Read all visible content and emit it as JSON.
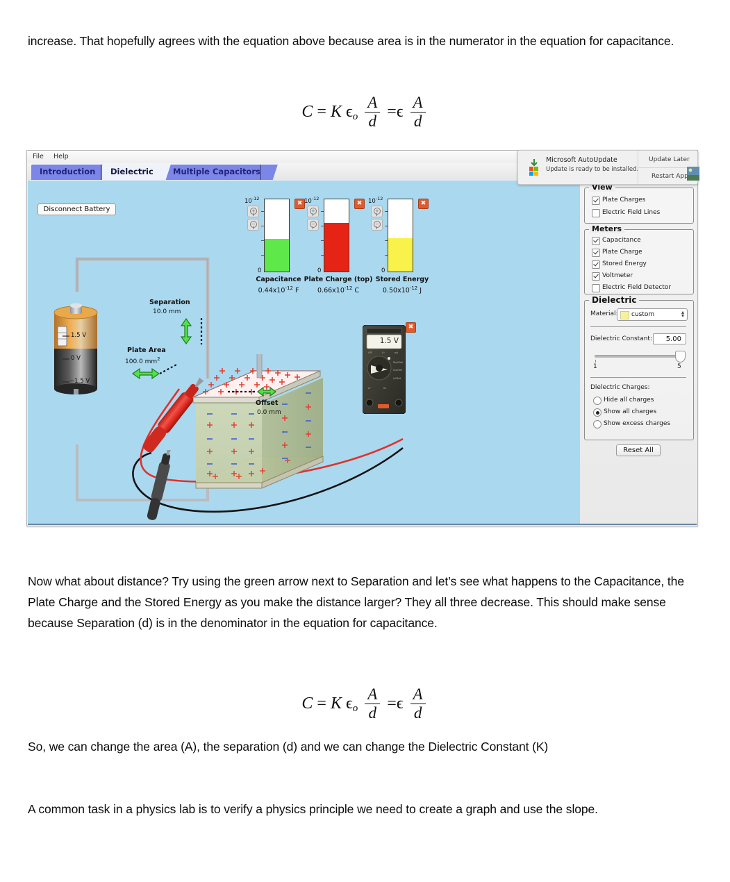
{
  "document": {
    "para1": "increase.  That hopefully agrees with the equation above because area is in the numerator in the equation for capacitance.",
    "para2": "Now what about distance?  Try using the green arrow next to Separation and let’s see what happens to the Capacitance, the Plate Charge and the Stored Energy as you make the distance larger?  They all three decrease.  This should make sense because Separation (d) is in the denominator in the equation for capacitance.",
    "para3": "So, we can change the area (A), the separation (d) and we can change the Dielectric Constant (K)",
    "para4": "A common task in a physics lab is to verify a physics principle we need to create a graph and use the slope.",
    "equation": {
      "lhs": "C",
      "eq1": "=",
      "k": "K",
      "eps": "ϵ",
      "eps_sub": "o",
      "num1": "A",
      "den1": "d",
      "eq2": "=",
      "eps2": "ϵ",
      "num2": "A",
      "den2": "d"
    }
  },
  "sim": {
    "menu": {
      "file": "File",
      "help": "Help"
    },
    "tabs": [
      {
        "label": "Introduction",
        "active": false
      },
      {
        "label": "Dielectric",
        "active": true
      },
      {
        "label": "Multiple Capacitors",
        "active": false
      }
    ],
    "canvas": {
      "disconnect_battery": "Disconnect Battery",
      "battery": {
        "top_label": "1.5 V",
        "mid_label": "0 V",
        "bottom_label": "−1.5 V"
      },
      "separation": {
        "title": "Separation",
        "value": "10.0 mm"
      },
      "plate_area": {
        "title": "Plate Area",
        "value": "100.0 mm",
        "value_sup": "2"
      },
      "offset": {
        "title": "Offset",
        "value": "0.0 mm"
      },
      "voltmeter": {
        "reading": "1.5 V"
      }
    },
    "meters": [
      {
        "exponent_base": "10",
        "exponent_sup": "-12",
        "zero": "0",
        "title": "Capacitance",
        "value_mantissa": "0.44x10",
        "value_sup": "-12",
        "value_unit": "F",
        "fill_color": "#5ee84a",
        "fill_fraction": 0.45
      },
      {
        "exponent_base": "10",
        "exponent_sup": "-12",
        "zero": "0",
        "title": "Plate Charge (top)",
        "value_mantissa": "0.66x10",
        "value_sup": "-12",
        "value_unit": "C",
        "fill_color": "#e62415",
        "fill_fraction": 0.67
      },
      {
        "exponent_base": "10",
        "exponent_sup": "-12",
        "zero": "0",
        "title": "Stored Energy",
        "value_mantissa": "0.50x10",
        "value_sup": "-12",
        "value_unit": "J",
        "fill_color": "#f8f24a",
        "fill_fraction": 0.46
      }
    ],
    "panel": {
      "view": {
        "legend": "View",
        "items": [
          {
            "label": "Plate Charges",
            "checked": true
          },
          {
            "label": "Electric Field Lines",
            "checked": false
          }
        ]
      },
      "meters_group": {
        "legend": "Meters",
        "items": [
          {
            "label": "Capacitance",
            "checked": true
          },
          {
            "label": "Plate Charge",
            "checked": true
          },
          {
            "label": "Stored Energy",
            "checked": true
          },
          {
            "label": "Voltmeter",
            "checked": true
          },
          {
            "label": "Electric Field Detector",
            "checked": false
          }
        ]
      },
      "dielectric": {
        "legend": "Dielectric",
        "material_label": "Material:",
        "material_value": "custom",
        "material_swatch": "#f7f29a",
        "constant_label": "Dielectric Constant:",
        "constant_value": "5.00",
        "slider_min": "1",
        "slider_max": "5",
        "slider_fraction": 1.0,
        "charges_label": "Dielectric Charges:",
        "charge_options": [
          {
            "label": "Hide all charges",
            "selected": false
          },
          {
            "label": "Show all charges",
            "selected": true
          },
          {
            "label": "Show excess charges",
            "selected": false
          }
        ]
      },
      "reset_all": "Reset All"
    }
  },
  "toast": {
    "title": "Microsoft AutoUpdate",
    "subtitle": "Update is ready to be installed.",
    "update_later": "Update Later",
    "restart_app": "Restart App"
  }
}
